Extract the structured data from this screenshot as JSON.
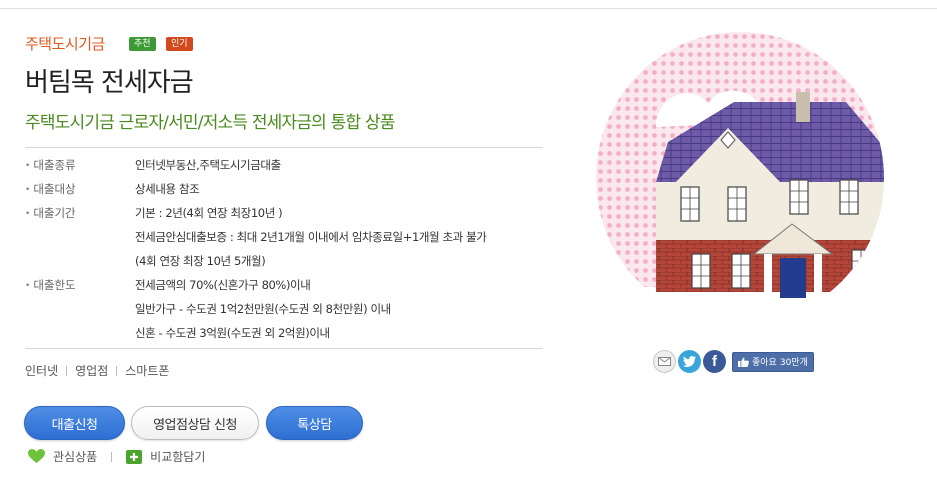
{
  "header": {
    "category": "주택도시기금",
    "badges": {
      "recommend": "추천",
      "popular": "인기"
    },
    "title": "버팀목 전세자금",
    "subtitle": "주택도시기금 근로자/서민/저소득 전세자금의 통합 상품"
  },
  "details": [
    {
      "label": "대출종류",
      "lines": [
        "인터넷부동산,주택도시기금대출"
      ]
    },
    {
      "label": "대출대상",
      "lines": [
        "상세내용 참조"
      ]
    },
    {
      "label": "대출기간",
      "lines": [
        "기본 : 2년(4회 연장 최장10년 )",
        "전세금안심대출보증 : 최대 2년1개월 이내에서 임차종료일+1개월 초과 불가",
        "(4회 연장 최장 10년 5개월)"
      ]
    },
    {
      "label": "대출한도",
      "lines": [
        "전세금액의 70%(신혼가구 80%)이내",
        "일반가구 - 수도권 1억2천만원(수도권 외 8천만원) 이내",
        "신혼 - 수도권 3억원(수도권 외 2억원)이내"
      ]
    }
  ],
  "channels": [
    "인터넷",
    "영업점",
    "스마트폰"
  ],
  "buttons": {
    "apply": "대출신청",
    "branch": "영업점상담 신청",
    "special": "톡상담"
  },
  "bottom_links": {
    "interest": "관심상품",
    "compare": "비교함담기"
  },
  "share": {
    "icons": [
      "email-icon",
      "twitter-icon",
      "facebook-icon",
      "thumbs-up-icon"
    ],
    "like_label": "좋아요",
    "like_count": "30만개"
  },
  "colors": {
    "accent_orange": "#e05a1c",
    "accent_green": "#4a8a1e",
    "button_blue": "#2d6fd2",
    "badge_green": "#3d9a36",
    "badge_red": "#d04a1e"
  }
}
